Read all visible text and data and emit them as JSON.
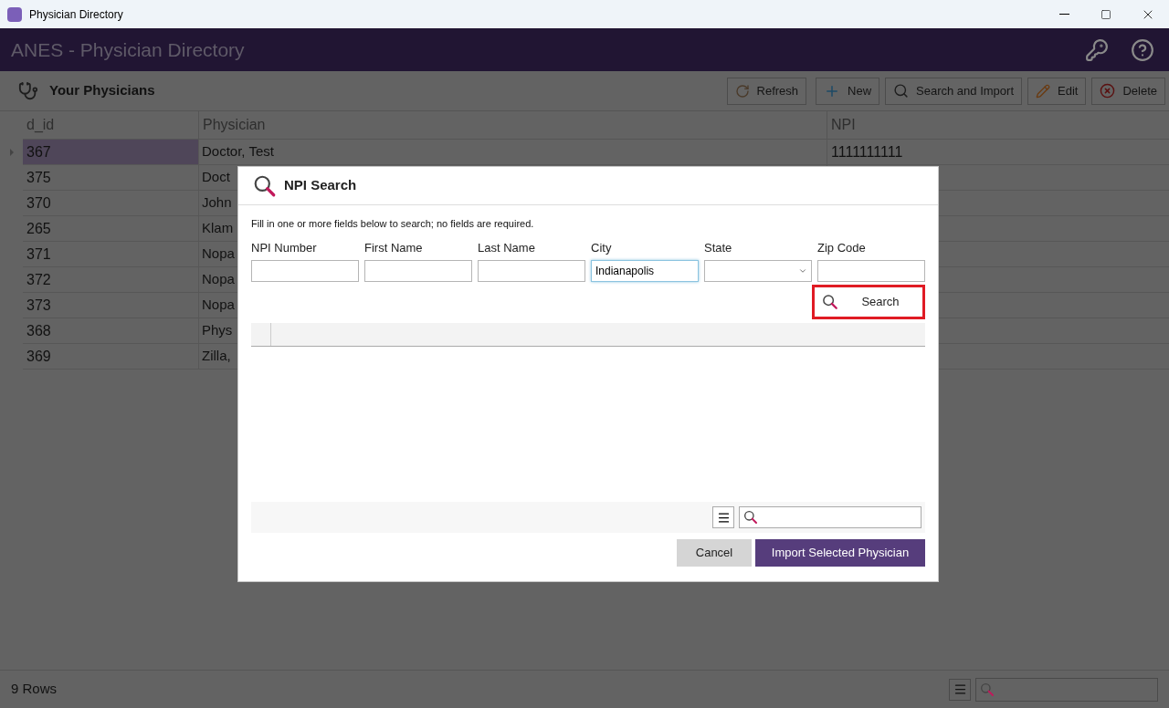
{
  "window": {
    "title": "Physician Directory"
  },
  "app_header": {
    "title": "ANES - Physician Directory"
  },
  "toolbar": {
    "title": "Your Physicians",
    "buttons": [
      {
        "kind": "refresh",
        "label": "Refresh"
      },
      {
        "kind": "new",
        "label": "New"
      },
      {
        "kind": "search",
        "label": "Search and Import"
      },
      {
        "kind": "edit",
        "label": "Edit"
      },
      {
        "kind": "delete",
        "label": "Delete"
      }
    ]
  },
  "table": {
    "columns": [
      "d_id",
      "Physician",
      "NPI"
    ],
    "rows": [
      {
        "d_id": "367",
        "physician": "Doctor, Test",
        "npi": "1111111111",
        "selected": true
      },
      {
        "d_id": "375",
        "physician": "Doct",
        "selected": false
      },
      {
        "d_id": "370",
        "physician": "John",
        "selected": false
      },
      {
        "d_id": "265",
        "physician": "Klam",
        "selected": false
      },
      {
        "d_id": "371",
        "physician": "Nopa",
        "selected": false
      },
      {
        "d_id": "372",
        "physician": "Nopa",
        "selected": false
      },
      {
        "d_id": "373",
        "physician": "Nopa",
        "selected": false
      },
      {
        "d_id": "368",
        "physician": "Phys",
        "selected": false
      },
      {
        "d_id": "369",
        "physician": "Zilla,",
        "selected": false
      }
    ]
  },
  "status_bar": {
    "row_count": "9 Rows"
  },
  "dialog": {
    "title": "NPI Search",
    "instructions": "Fill in one or more fields below to search; no fields are required.",
    "fields": [
      {
        "kind": "text",
        "label": "NPI Number",
        "focused": false
      },
      {
        "kind": "text",
        "label": "First Name",
        "focused": false
      },
      {
        "kind": "text",
        "label": "Last Name",
        "focused": false
      },
      {
        "kind": "text",
        "label": "City",
        "value": "Indianapolis",
        "focused": true
      },
      {
        "kind": "dropdown",
        "label": "State",
        "focused": false
      },
      {
        "kind": "text",
        "label": "Zip Code",
        "focused": false
      }
    ],
    "search_button": {
      "label": "Search",
      "highlighted": true
    },
    "buttons": [
      {
        "kind": "secondary",
        "label": "Cancel"
      },
      {
        "kind": "primary",
        "label": "Import Selected Physician"
      }
    ]
  }
}
